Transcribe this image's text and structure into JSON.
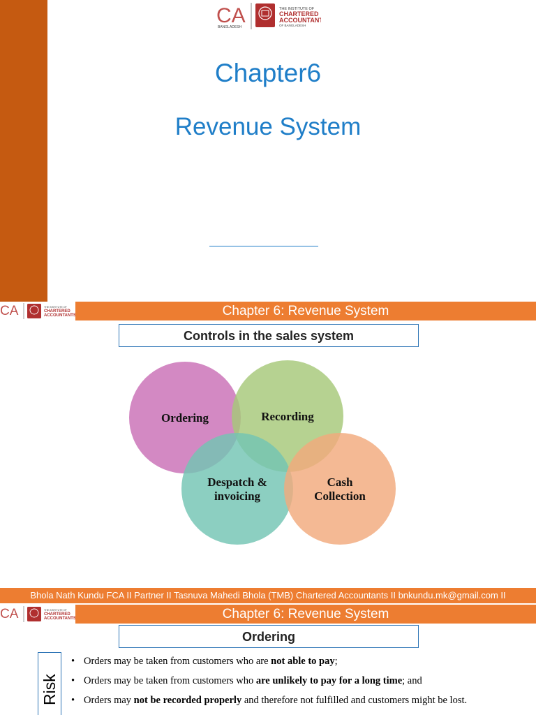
{
  "slide1": {
    "logo": {
      "ca_mark": "CA",
      "ca_country": "BANGLADESH",
      "institute_line1": "THE INSTITUTE OF",
      "institute_line2": "CHARTERED",
      "institute_line3": "ACCOUNTANTS",
      "institute_line4": "OF BANGLADESH"
    },
    "title": "Chapter6",
    "subtitle": "Revenue System"
  },
  "slide2": {
    "header": "Chapter 6: Revenue System",
    "heading": "Controls in the sales system",
    "venn": {
      "ordering": "Ordering",
      "recording": "Recording",
      "despatch_line1": "Despatch &",
      "despatch_line2": "invoicing",
      "cash_line1": "Cash",
      "cash_line2": "Collection"
    },
    "colors": {
      "ordering": "#c96fb6",
      "recording": "#a6c879",
      "despatch": "#73c4b3",
      "cash": "#f1a97c"
    },
    "footer": "Bhola Nath Kundu FCA II Partner II Tasnuva Mahedi Bhola (TMB) Chartered Accountants II bnkundu.mk@gmail.com II"
  },
  "slide3": {
    "header": "Chapter 6: Revenue System",
    "heading": "Ordering",
    "side_label": "Risk",
    "bullets": [
      {
        "pre": "Orders may be taken from customers who are ",
        "bold": "not able to pay",
        "post": ";"
      },
      {
        "pre": "Orders may be taken from customers who ",
        "bold": "are unlikely to pay for a long time",
        "post": "; and"
      },
      {
        "pre": "Orders may ",
        "bold": "not be recorded properly",
        "post": " and therefore not fulfilled and customers might be lost."
      }
    ]
  },
  "accent_colors": {
    "sidebar": "#c55a11",
    "band": "#ed7d31",
    "title_blue": "#1f7ec8"
  }
}
